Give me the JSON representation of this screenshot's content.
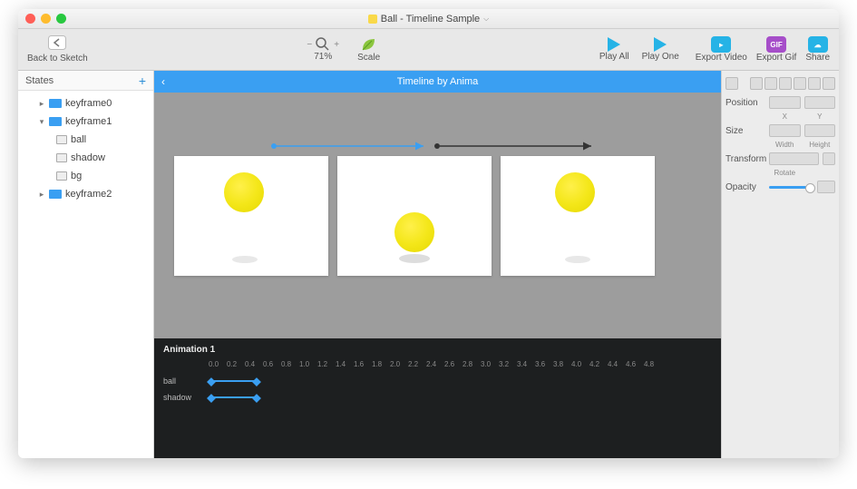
{
  "title": "Ball - Timeline Sample",
  "toolbar": {
    "back_label": "Back to Sketch",
    "zoom_pct": "71%",
    "scale_label": "Scale",
    "play_all": "Play All",
    "play_one": "Play One",
    "export_video": "Export Video",
    "export_gif": "Export Gif",
    "share": "Share"
  },
  "sidebar": {
    "title": "States",
    "items": [
      {
        "label": "keyframe0"
      },
      {
        "label": "keyframe1"
      },
      {
        "label": "ball"
      },
      {
        "label": "shadow"
      },
      {
        "label": "bg"
      },
      {
        "label": "keyframe2"
      }
    ]
  },
  "bluebar": {
    "title": "Timeline by Anima"
  },
  "anim": {
    "title": "Animation 1",
    "ticks": [
      "0.0",
      "0.2",
      "0.4",
      "0.6",
      "0.8",
      "1.0",
      "1.2",
      "1.4",
      "1.6",
      "1.8",
      "2.0",
      "2.2",
      "2.4",
      "2.6",
      "2.8",
      "3.0",
      "3.2",
      "3.4",
      "3.6",
      "3.8",
      "4.0",
      "4.2",
      "4.4",
      "4.6",
      "4.8"
    ],
    "tracks": [
      {
        "label": "ball"
      },
      {
        "label": "shadow"
      }
    ]
  },
  "inspector": {
    "position": "Position",
    "x": "X",
    "y": "Y",
    "size": "Size",
    "width": "Width",
    "height": "Height",
    "transform": "Transform",
    "rotate": "Rotate",
    "opacity": "Opacity"
  }
}
